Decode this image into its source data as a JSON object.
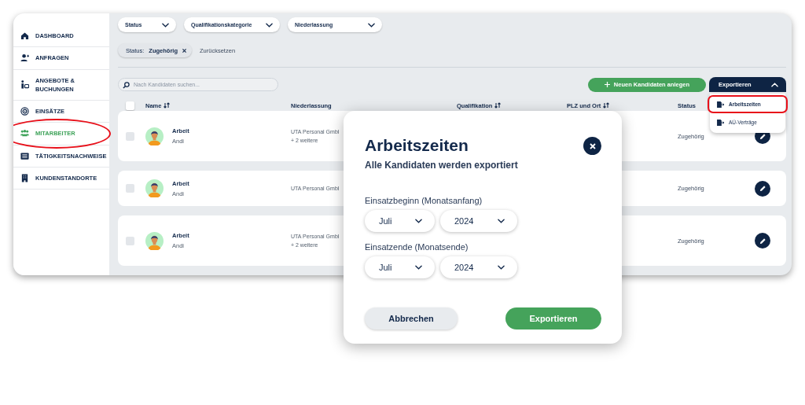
{
  "sidebar": {
    "items": [
      {
        "label": "DASHBOARD",
        "selected": false,
        "highlighted": false
      },
      {
        "label": "ANFRAGEN",
        "selected": false,
        "highlighted": false
      },
      {
        "label": "ANGEBOTE & BUCHUNGEN",
        "selected": false,
        "highlighted": false
      },
      {
        "label": "EINSÄTZE",
        "selected": false,
        "highlighted": false
      },
      {
        "label": "MITARBEITER",
        "selected": true,
        "highlighted": true
      },
      {
        "label": "TÄTIGKEITSNACHWEISE",
        "selected": false,
        "highlighted": false
      },
      {
        "label": "KUNDENSTANDORTE",
        "selected": false,
        "highlighted": false
      }
    ]
  },
  "filters": [
    {
      "label": "Status"
    },
    {
      "label": "Qualifikationskategorie"
    },
    {
      "label": "Niederlassung"
    }
  ],
  "active_filters": [
    {
      "label": "Status: **Zugehörig**"
    }
  ],
  "reset_link": "Zurücksetzen",
  "search": {
    "placeholder": "Nach Kandidaten suchen..."
  },
  "new_button": "Neuen Kandidaten anlegen",
  "export_menu": {
    "label": "Exportieren",
    "expanded": true,
    "items": [
      {
        "label": "Arbeitszeiten",
        "selected": true,
        "highlighted": true
      },
      {
        "label": "AÜ-Verträge",
        "selected": false,
        "highlighted": false
      }
    ]
  },
  "table": {
    "header_checked": false,
    "columns": [
      {
        "label": "Name",
        "sortable": true
      },
      {
        "label": "Niederlassung",
        "sortable": false
      },
      {
        "label": "Qualifikation",
        "sortable": true
      },
      {
        "label": "PLZ und Ort",
        "sortable": true
      },
      {
        "label": "Status",
        "sortable": false
      }
    ],
    "rows": [
      {
        "checked": false,
        "title": "Arbeit",
        "name": "Andi",
        "branch": "UTA Personal Gmbl",
        "more": "+ 2 weitere",
        "status": "Zugehörig"
      },
      {
        "checked": false,
        "title": "Arbeit",
        "name": "Andi",
        "branch": "UTA Personal Gmbl",
        "status": "Zugehörig"
      },
      {
        "checked": false,
        "title": "Arbeit",
        "name": "Andi",
        "branch": "UTA Personal Gmbl",
        "more": "+ 2 weitere",
        "status": "Zugehörig"
      }
    ]
  },
  "dialog": {
    "title": "Arbeitszeiten",
    "subtitle": "Alle Kandidaten werden exportiert",
    "fields": [
      {
        "label": "Einsatzbeginn (Monatsanfang)",
        "month": "Juli",
        "year": "2024"
      },
      {
        "label": "Einsatzende (Monatsende)",
        "month": "Juli",
        "year": "2024"
      }
    ],
    "cancel": "Abbrechen",
    "confirm": "Exportieren"
  }
}
